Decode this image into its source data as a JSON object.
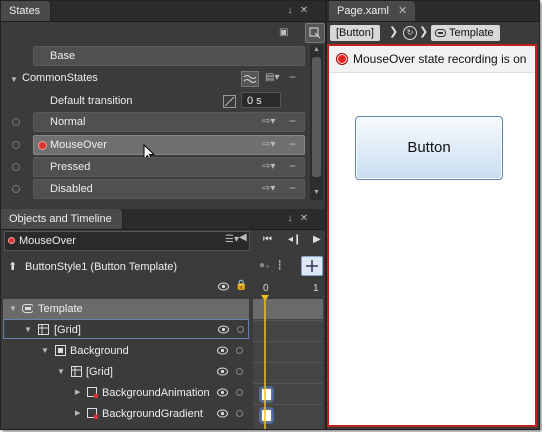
{
  "states_panel": {
    "title": "States",
    "base_label": "Base",
    "group_label": "CommonStates",
    "default_transition_label": "Default transition",
    "default_transition_value": "0 s",
    "states": [
      {
        "label": "Normal"
      },
      {
        "label": "MouseOver"
      },
      {
        "label": "Pressed"
      },
      {
        "label": "Disabled"
      }
    ]
  },
  "objects_panel": {
    "title": "Objects and Timeline",
    "storyboard_label": "MouseOver",
    "scope_label": "ButtonStyle1 (Button Template)",
    "timeline_ticks": [
      "0",
      "1"
    ],
    "tree": [
      {
        "label": "Template"
      },
      {
        "label": "[Grid]"
      },
      {
        "label": "Background"
      },
      {
        "label": "[Grid]"
      },
      {
        "label": "BackgroundAnimation"
      },
      {
        "label": "BackgroundGradient"
      }
    ]
  },
  "document": {
    "tab_label": "Page.xaml",
    "crumbs": [
      "[Button]",
      "Template"
    ],
    "recording_text": "MouseOver state recording is on",
    "button_text": "Button"
  },
  "colors": {
    "recording_border": "#c02020",
    "playhead": "#f0c020",
    "selection_outline": "#6b7fb3"
  }
}
